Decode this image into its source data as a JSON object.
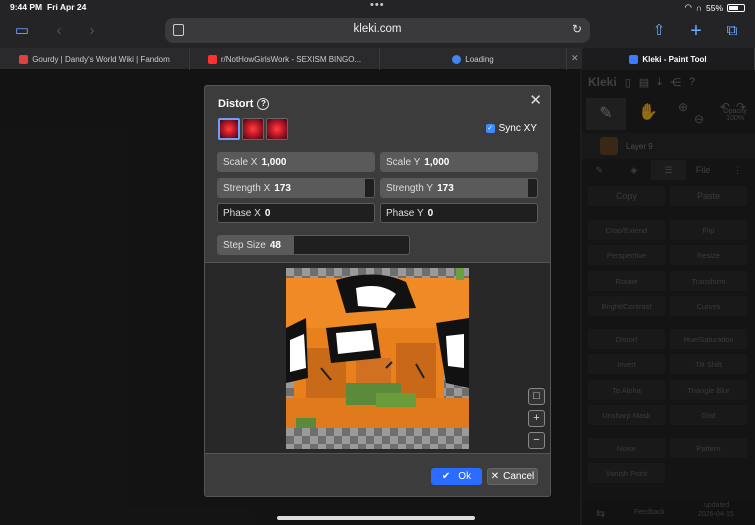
{
  "status": {
    "time": "9:44 PM",
    "date": "Fri Apr 24",
    "battery": "55%"
  },
  "browser": {
    "url": "kleki.com"
  },
  "tabs": [
    {
      "title": "Gourdy | Dandy's World Wiki | Fandom",
      "favicon_color": "#e04040"
    },
    {
      "title": "r/NotHowGirlsWork - SEXISM BINGO...",
      "favicon_color": "#ff3030"
    },
    {
      "title": "Loading",
      "favicon_color": "#4285f4"
    },
    {
      "title": "Kleki - Paint Tool",
      "favicon_color": "#3a7bff"
    }
  ],
  "sidebar": {
    "logo": "Kleki",
    "layer_name": "Layer 9",
    "opacity_label": "Opacity",
    "opacity_value": "100%",
    "tab_file": "File",
    "buttons": [
      "Copy",
      "Paste",
      "Crop/Extend",
      "Flip",
      "Perspective",
      "Resize",
      "Rotate",
      "Transform",
      "Bright/Contrast",
      "Curves",
      "Distort",
      "Hue/Saturation",
      "Invert",
      "Tilt Shift",
      "To Alpha",
      "Triangle Blur",
      "Unsharp Mask",
      "Grid",
      "Noise",
      "Pattern",
      "Vanish Point"
    ],
    "feedback": "Feedback",
    "updated_label": "updated",
    "updated_date": "2026-04-15"
  },
  "dialog": {
    "title": "Distort",
    "sync_label": "Sync XY",
    "sync_checked": true,
    "sliders": {
      "scale_x": {
        "label": "Scale X",
        "value": "1,000"
      },
      "scale_y": {
        "label": "Scale Y",
        "value": "1,000"
      },
      "strength_x": {
        "label": "Strength X",
        "value": "173",
        "fill": 0.94
      },
      "strength_y": {
        "label": "Strength Y",
        "value": "173",
        "fill": 0.94
      },
      "phase_x": {
        "label": "Phase X",
        "value": "0",
        "fill": 0
      },
      "phase_y": {
        "label": "Phase Y",
        "value": "0",
        "fill": 0
      },
      "step_size": {
        "label": "Step Size",
        "value": "48",
        "fill": 0.4
      }
    },
    "ok_label": "Ok",
    "cancel_label": "Cancel"
  }
}
